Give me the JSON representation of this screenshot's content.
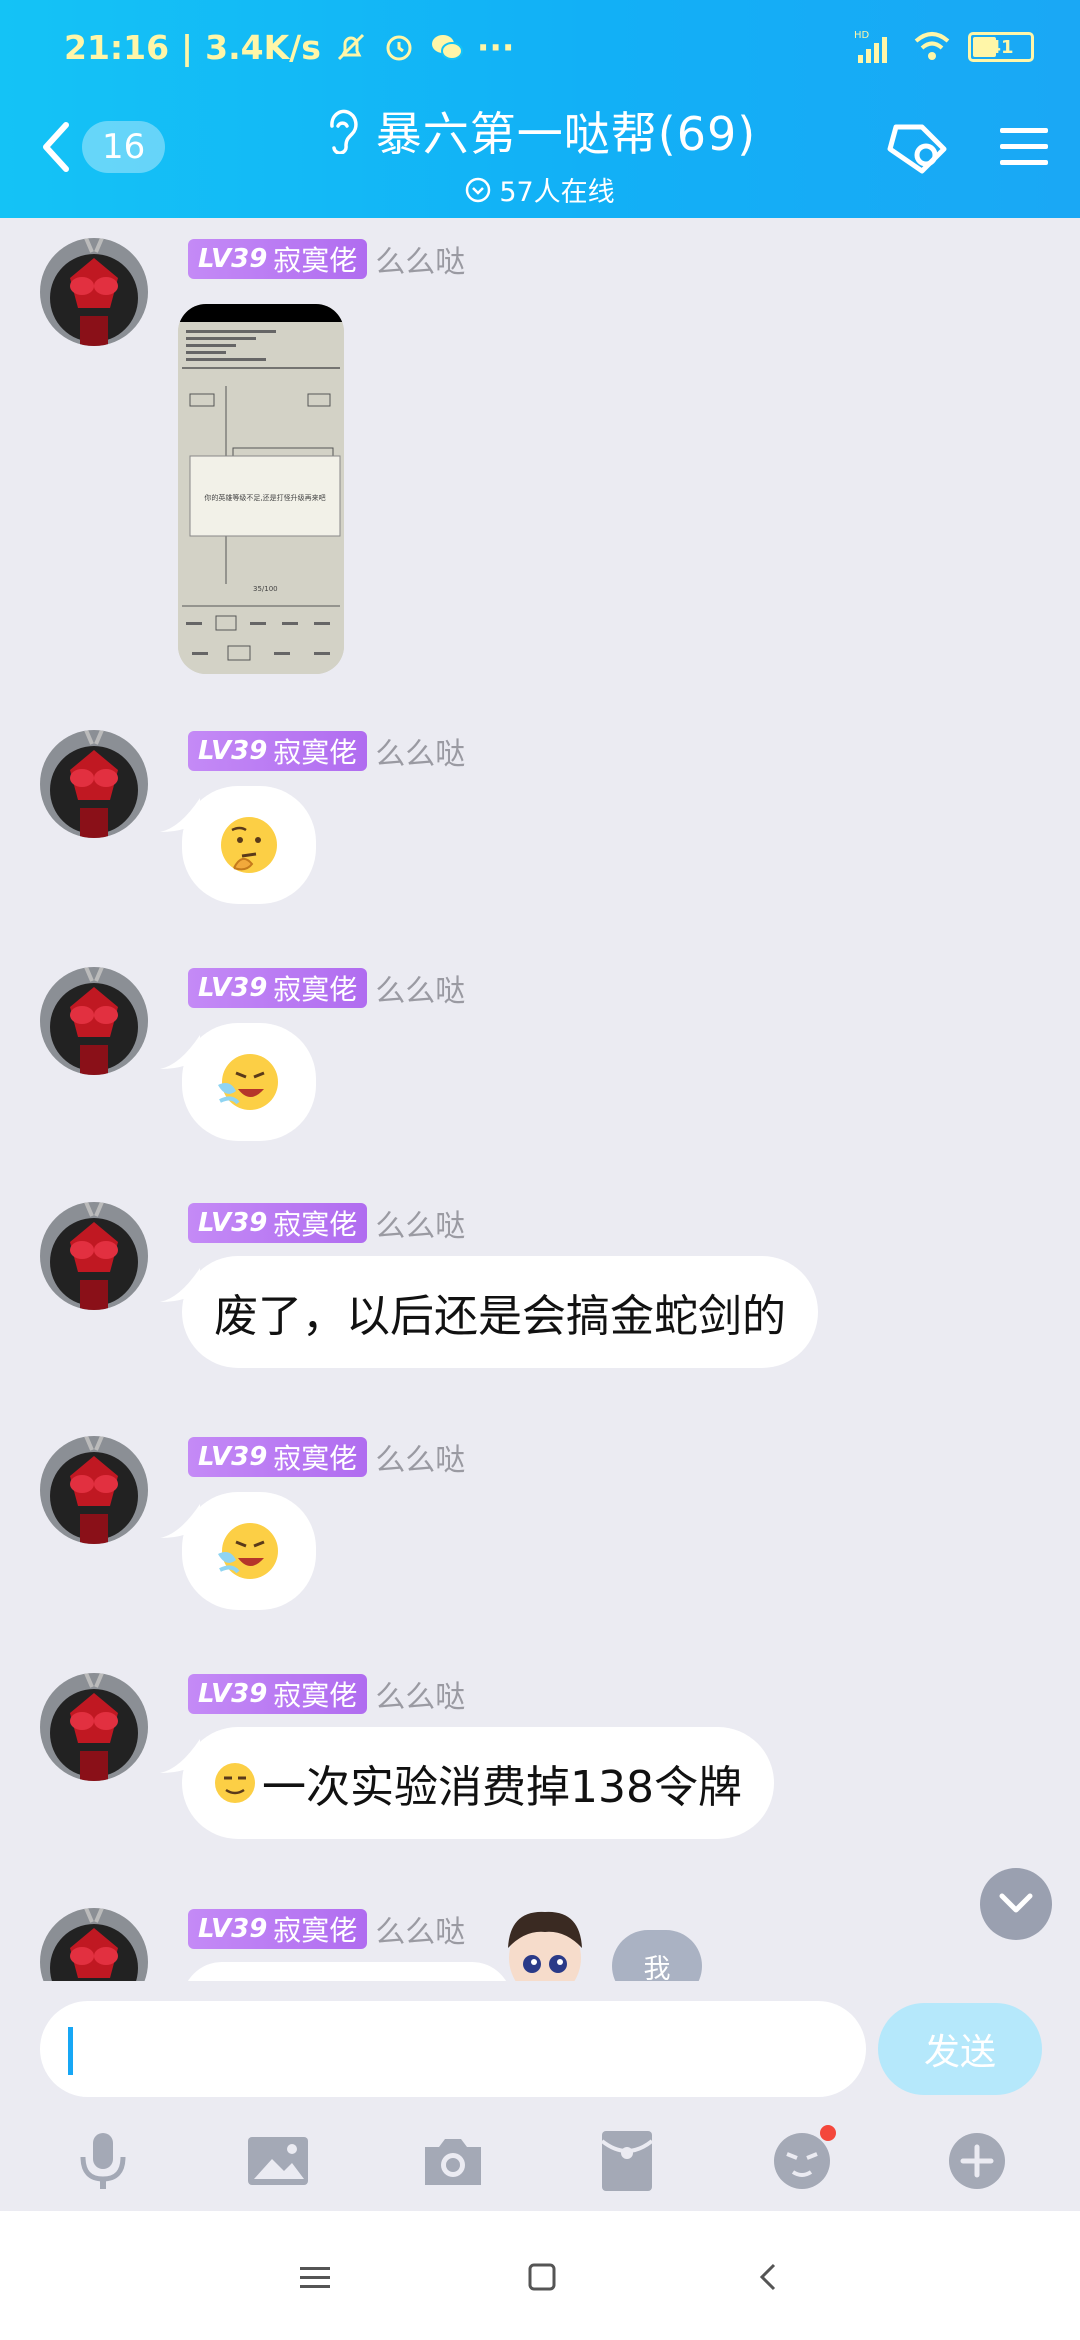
{
  "status_bar": {
    "time": "21:16",
    "speed": "3.4K/s",
    "more": "···",
    "battery": "41",
    "network": "HD"
  },
  "header": {
    "back_count": "16",
    "title": "暴六第一哒帮(69)",
    "online": "57人在线"
  },
  "messages": [
    {
      "level": "LV39",
      "title": "寂寞佬",
      "nick": "么么哒",
      "type": "image"
    },
    {
      "level": "LV39",
      "title": "寂寞佬",
      "nick": "么么哒",
      "type": "emoji",
      "emoji": "thinking-face-icon"
    },
    {
      "level": "LV39",
      "title": "寂寞佬",
      "nick": "么么哒",
      "type": "emoji",
      "emoji": "crying-laughing-face-icon"
    },
    {
      "level": "LV39",
      "title": "寂寞佬",
      "nick": "么么哒",
      "type": "text",
      "text": "废了，以后还是会搞金蛇剑的"
    },
    {
      "level": "LV39",
      "title": "寂寞佬",
      "nick": "么么哒",
      "type": "emoji",
      "emoji": "crying-laughing-face-icon"
    },
    {
      "level": "LV39",
      "title": "寂寞佬",
      "nick": "么么哒",
      "type": "text",
      "text": "一次实验消费掉138令牌"
    },
    {
      "level": "LV39",
      "title": "寂寞佬",
      "nick": "么么哒",
      "type": "partial"
    }
  ],
  "screenshot_image": {
    "popup_text": "你的英雄等级不足,还是打怪升级再来吧",
    "counter": "35/100"
  },
  "floating": {
    "me_label": "我"
  },
  "input": {
    "placeholder": "",
    "send_label": "发送"
  },
  "toolbar": [
    "microphone-icon",
    "image-icon",
    "camera-icon",
    "red-packet-icon",
    "sticker-icon",
    "plus-icon"
  ],
  "colors": {
    "header": "#12b0f6",
    "badge": "#b06cf0",
    "send_disabled": "#b5e8fb",
    "notification_dot": "#f4473c"
  }
}
